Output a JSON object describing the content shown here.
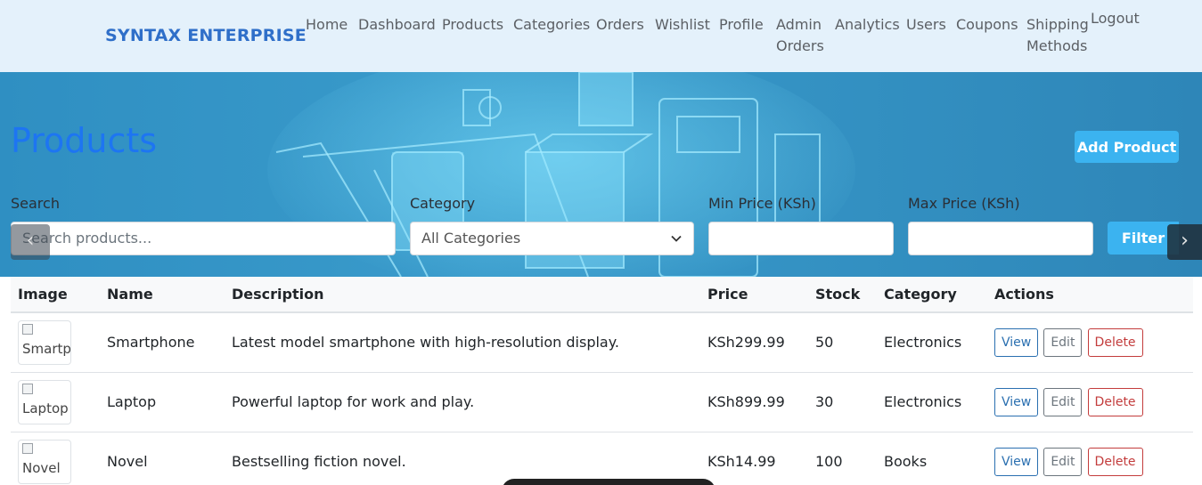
{
  "navbar": {
    "brand": "SYNTAX ENTERPRISE",
    "links": [
      "Home",
      "Dashboard",
      "Products",
      "Categories",
      "Orders",
      "Wishlist",
      "Profile",
      "Admin",
      "Orders",
      "Analytics",
      "Users",
      "Coupons",
      "Shipping",
      "Methods",
      "Logout"
    ]
  },
  "page": {
    "title": "Products",
    "add_button": "Add Product"
  },
  "filters": {
    "search_label": "Search",
    "search_placeholder": "Search products...",
    "category_label": "Category",
    "category_selected": "All Categories",
    "min_label": "Min Price (KSh)",
    "max_label": "Max Price (KSh)",
    "filter_button": "Filter"
  },
  "carousel": {
    "prev": "‹",
    "next": "›"
  },
  "table": {
    "headers": [
      "Image",
      "Name",
      "Description",
      "Price",
      "Stock",
      "Category",
      "Actions"
    ],
    "rows": [
      {
        "img_alt": "Smartphone",
        "name": "Smartphone",
        "description": "Latest model smartphone with high-resolution display.",
        "price": "KSh299.99",
        "stock": "50",
        "category": "Electronics"
      },
      {
        "img_alt": "Laptop",
        "name": "Laptop",
        "description": "Powerful laptop for work and play.",
        "price": "KSh899.99",
        "stock": "30",
        "category": "Electronics"
      },
      {
        "img_alt": "Novel",
        "name": "Novel",
        "description": "Bestselling fiction novel.",
        "price": "KSh14.99",
        "stock": "100",
        "category": "Books"
      }
    ],
    "actions": {
      "view": "View",
      "edit": "Edit",
      "delete": "Delete"
    }
  }
}
